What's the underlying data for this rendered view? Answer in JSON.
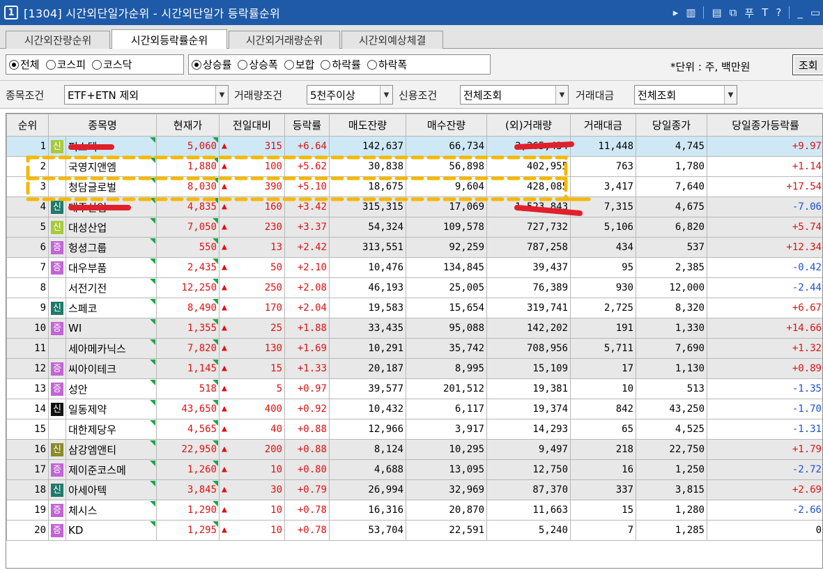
{
  "window": {
    "number": "1",
    "title": "[1304] 시간외단일가순위 - 시간외단일가 등락률순위",
    "tools": [
      "▸",
      "▥",
      "▤",
      "⧉",
      "푸",
      "T",
      "?",
      "_",
      "▭"
    ]
  },
  "tabs": [
    {
      "label": "시간외잔량순위",
      "active": false
    },
    {
      "label": "시간외등락률순위",
      "active": true
    },
    {
      "label": "시간외거래량순위",
      "active": false
    },
    {
      "label": "시간외예상체결",
      "active": false
    }
  ],
  "market_options": [
    {
      "label": "전체",
      "selected": true
    },
    {
      "label": "코스피",
      "selected": false
    },
    {
      "label": "코스닥",
      "selected": false
    }
  ],
  "sort_options": [
    {
      "label": "상승률",
      "selected": true
    },
    {
      "label": "상승폭",
      "selected": false
    },
    {
      "label": "보합",
      "selected": false
    },
    {
      "label": "하락률",
      "selected": false
    },
    {
      "label": "하락폭",
      "selected": false
    }
  ],
  "unit_note": "*단위 : 주, 백만원",
  "query_button": "조회",
  "filters": {
    "stock_label": "종목조건",
    "stock_value": "ETF+ETN 제외",
    "volume_label": "거래량조건",
    "volume_value": "5천주이상",
    "credit_label": "신용조건",
    "credit_value": "전체조회",
    "amount_label": "거래대금",
    "amount_value": "전체조회"
  },
  "columns": [
    "순위",
    "종목명",
    "현재가",
    "전일대비",
    "등락률",
    "매도잔량",
    "매수잔량",
    "(외)거래량",
    "거래대금",
    "당일종가",
    "당일종가등락률"
  ],
  "colors": {
    "badge_sin_light": "#a8c93a",
    "badge_jeung": "#c264d6",
    "badge_sin_teal": "#1f7a6a",
    "badge_sin_black": "#111111",
    "badge_sin_olive": "#8a8a2a",
    "up": "#e01010",
    "down": "#1a4fd6",
    "highlight": "#f5b800",
    "redaction": "#e0202a"
  },
  "rows": [
    {
      "rank": "1",
      "badge": "신",
      "badge_color": "#a8c93a",
      "name": "퍼스텍",
      "price": "5,060",
      "change": "315",
      "rate": "+6.64",
      "ask": "142,637",
      "bid": "66,734",
      "volume": "2,265,434",
      "amount": "11,448",
      "close": "4,745",
      "close_rate": "+9.97",
      "dir": "up",
      "style": "sel"
    },
    {
      "rank": "2",
      "badge": "",
      "badge_color": "",
      "name": "국영지앤엠",
      "price": "1,880",
      "change": "100",
      "rate": "+5.62",
      "ask": "30,838",
      "bid": "56,898",
      "volume": "402,955",
      "amount": "763",
      "close": "1,780",
      "close_rate": "+1.14",
      "dir": "up",
      "style": ""
    },
    {
      "rank": "3",
      "badge": "",
      "badge_color": "",
      "name": "청담글로벌",
      "price": "8,030",
      "change": "390",
      "rate": "+5.10",
      "ask": "18,675",
      "bid": "9,604",
      "volume": "428,085",
      "amount": "3,417",
      "close": "7,640",
      "close_rate": "+17.54",
      "dir": "up",
      "style": ""
    },
    {
      "rank": "4",
      "badge": "신",
      "badge_color": "#1f7a6a",
      "name": "대주산업",
      "price": "4,835",
      "change": "160",
      "rate": "+3.42",
      "ask": "315,315",
      "bid": "17,069",
      "volume": "1,523,843",
      "amount": "7,315",
      "close": "4,675",
      "close_rate": "-7.06",
      "dir": "down",
      "style": "gray"
    },
    {
      "rank": "5",
      "badge": "신",
      "badge_color": "#a8c93a",
      "name": "대성산업",
      "price": "7,050",
      "change": "230",
      "rate": "+3.37",
      "ask": "54,324",
      "bid": "109,578",
      "volume": "727,732",
      "amount": "5,106",
      "close": "6,820",
      "close_rate": "+5.74",
      "dir": "up",
      "style": "gray"
    },
    {
      "rank": "6",
      "badge": "증",
      "badge_color": "#c264d6",
      "name": "헝셩그룹",
      "price": "550",
      "change": "13",
      "rate": "+2.42",
      "ask": "313,551",
      "bid": "92,259",
      "volume": "787,258",
      "amount": "434",
      "close": "537",
      "close_rate": "+12.34",
      "dir": "up",
      "style": "gray"
    },
    {
      "rank": "7",
      "badge": "증",
      "badge_color": "#c264d6",
      "name": "대우부품",
      "price": "2,435",
      "change": "50",
      "rate": "+2.10",
      "ask": "10,476",
      "bid": "134,845",
      "volume": "39,437",
      "amount": "95",
      "close": "2,385",
      "close_rate": "-0.42",
      "dir": "down",
      "style": ""
    },
    {
      "rank": "8",
      "badge": "",
      "badge_color": "",
      "name": "서전기전",
      "price": "12,250",
      "change": "250",
      "rate": "+2.08",
      "ask": "46,193",
      "bid": "25,005",
      "volume": "76,389",
      "amount": "930",
      "close": "12,000",
      "close_rate": "-2.44",
      "dir": "down",
      "style": ""
    },
    {
      "rank": "9",
      "badge": "신",
      "badge_color": "#1f7a6a",
      "name": "스페코",
      "price": "8,490",
      "change": "170",
      "rate": "+2.04",
      "ask": "19,583",
      "bid": "15,654",
      "volume": "319,741",
      "amount": "2,725",
      "close": "8,320",
      "close_rate": "+6.67",
      "dir": "up",
      "style": ""
    },
    {
      "rank": "10",
      "badge": "증",
      "badge_color": "#c264d6",
      "name": "WI",
      "price": "1,355",
      "change": "25",
      "rate": "+1.88",
      "ask": "33,435",
      "bid": "95,088",
      "volume": "142,202",
      "amount": "191",
      "close": "1,330",
      "close_rate": "+14.66",
      "dir": "up",
      "style": "gray"
    },
    {
      "rank": "11",
      "badge": "",
      "badge_color": "",
      "name": "세아메카닉스",
      "price": "7,820",
      "change": "130",
      "rate": "+1.69",
      "ask": "10,291",
      "bid": "35,742",
      "volume": "708,956",
      "amount": "5,711",
      "close": "7,690",
      "close_rate": "+1.32",
      "dir": "up",
      "style": "gray"
    },
    {
      "rank": "12",
      "badge": "증",
      "badge_color": "#c264d6",
      "name": "씨아이테크",
      "price": "1,145",
      "change": "15",
      "rate": "+1.33",
      "ask": "20,187",
      "bid": "8,995",
      "volume": "15,109",
      "amount": "17",
      "close": "1,130",
      "close_rate": "+0.89",
      "dir": "up",
      "style": "gray"
    },
    {
      "rank": "13",
      "badge": "증",
      "badge_color": "#c264d6",
      "name": "성안",
      "price": "518",
      "change": "5",
      "rate": "+0.97",
      "ask": "39,577",
      "bid": "201,512",
      "volume": "19,381",
      "amount": "10",
      "close": "513",
      "close_rate": "-1.35",
      "dir": "down",
      "style": ""
    },
    {
      "rank": "14",
      "badge": "신",
      "badge_color": "#111111",
      "name": "일동제약",
      "price": "43,650",
      "change": "400",
      "rate": "+0.92",
      "ask": "10,432",
      "bid": "6,117",
      "volume": "19,374",
      "amount": "842",
      "close": "43,250",
      "close_rate": "-1.70",
      "dir": "down",
      "style": ""
    },
    {
      "rank": "15",
      "badge": "",
      "badge_color": "",
      "name": "대한제당우",
      "price": "4,565",
      "change": "40",
      "rate": "+0.88",
      "ask": "12,966",
      "bid": "3,917",
      "volume": "14,293",
      "amount": "65",
      "close": "4,525",
      "close_rate": "-1.31",
      "dir": "down",
      "style": ""
    },
    {
      "rank": "16",
      "badge": "신",
      "badge_color": "#8a8a2a",
      "name": "삼강엠앤티",
      "price": "22,950",
      "change": "200",
      "rate": "+0.88",
      "ask": "8,124",
      "bid": "10,295",
      "volume": "9,497",
      "amount": "218",
      "close": "22,750",
      "close_rate": "+1.79",
      "dir": "up",
      "style": "gray"
    },
    {
      "rank": "17",
      "badge": "증",
      "badge_color": "#c264d6",
      "name": "제이준코스메",
      "price": "1,260",
      "change": "10",
      "rate": "+0.80",
      "ask": "4,688",
      "bid": "13,095",
      "volume": "12,750",
      "amount": "16",
      "close": "1,250",
      "close_rate": "-2.72",
      "dir": "down",
      "style": "gray"
    },
    {
      "rank": "18",
      "badge": "신",
      "badge_color": "#1f7a6a",
      "name": "아세아텍",
      "price": "3,845",
      "change": "30",
      "rate": "+0.79",
      "ask": "26,994",
      "bid": "32,969",
      "volume": "87,370",
      "amount": "337",
      "close": "3,815",
      "close_rate": "+2.69",
      "dir": "up",
      "style": "gray"
    },
    {
      "rank": "19",
      "badge": "증",
      "badge_color": "#c264d6",
      "name": "체시스",
      "price": "1,290",
      "change": "10",
      "rate": "+0.78",
      "ask": "16,316",
      "bid": "20,870",
      "volume": "11,663",
      "amount": "15",
      "close": "1,280",
      "close_rate": "-2.66",
      "dir": "down",
      "style": ""
    },
    {
      "rank": "20",
      "badge": "증",
      "badge_color": "#c264d6",
      "name": "KD",
      "price": "1,295",
      "change": "10",
      "rate": "+0.78",
      "ask": "53,704",
      "bid": "22,591",
      "volume": "5,240",
      "amount": "7",
      "close": "1,285",
      "close_rate": "0",
      "dir": "flat",
      "style": ""
    }
  ]
}
